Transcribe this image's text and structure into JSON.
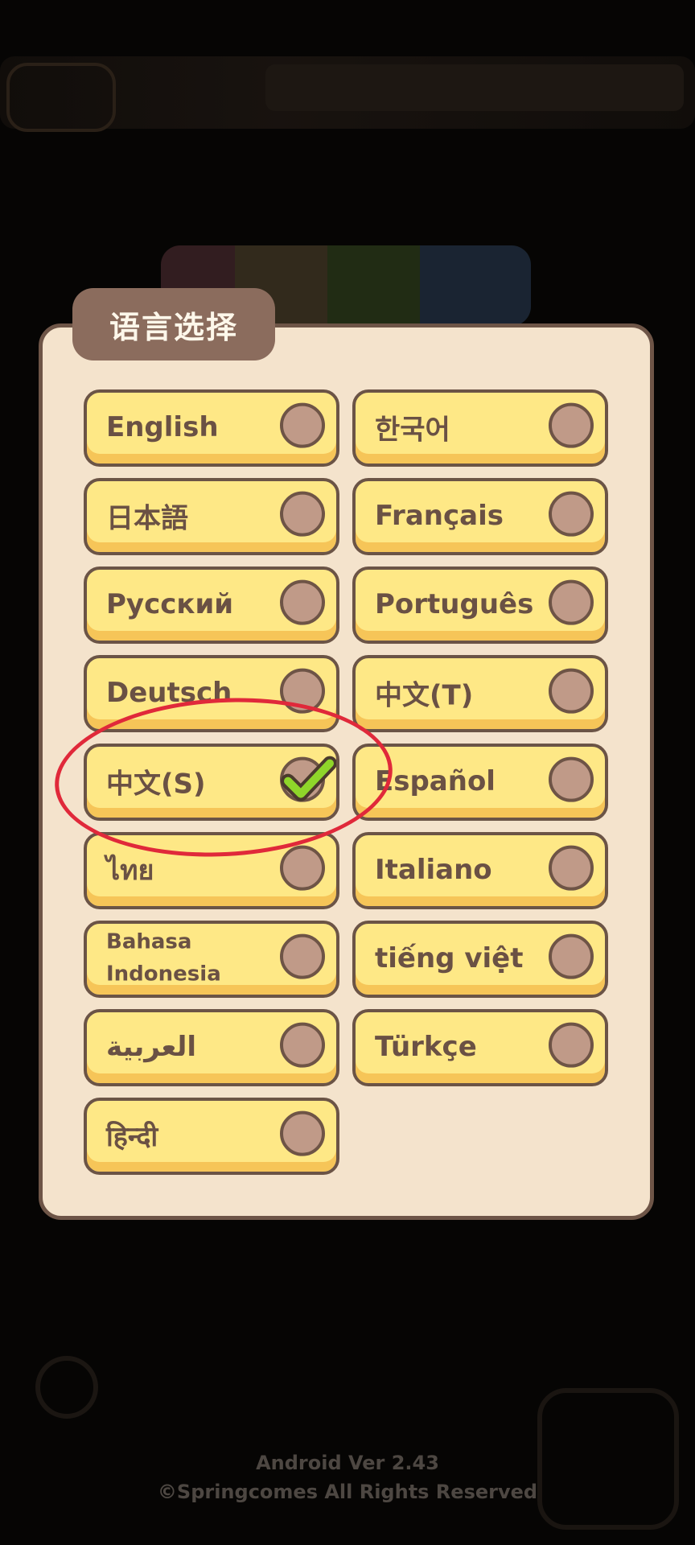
{
  "dialog": {
    "title": "语言选择"
  },
  "languages": [
    {
      "label": "English",
      "selected": false
    },
    {
      "label": "한국어",
      "selected": false
    },
    {
      "label": "日本語",
      "selected": false
    },
    {
      "label": "Français",
      "selected": false
    },
    {
      "label": "Русский",
      "selected": false
    },
    {
      "label": "Português",
      "selected": false
    },
    {
      "label": "Deutsch",
      "selected": false
    },
    {
      "label": "中文(T)",
      "selected": false
    },
    {
      "label": "中文(S)",
      "selected": true
    },
    {
      "label": "Español",
      "selected": false
    },
    {
      "label": "ไทย",
      "selected": false
    },
    {
      "label": "Italiano",
      "selected": false
    },
    {
      "label": "Bahasa Indonesia",
      "selected": false
    },
    {
      "label": "tiếng việt",
      "selected": false
    },
    {
      "label": "العربية",
      "selected": false
    },
    {
      "label": "Türkçe",
      "selected": false
    },
    {
      "label": "हिन्दी",
      "selected": false
    }
  ],
  "footer": {
    "version": "Android Ver 2.43",
    "copyright": "©Springcomes All Rights Reserved"
  },
  "colors": {
    "button_fill": "#fee886",
    "dialog_bg": "#f4e3cc",
    "annotation": "#e0293a",
    "check": "#8fd62a"
  }
}
